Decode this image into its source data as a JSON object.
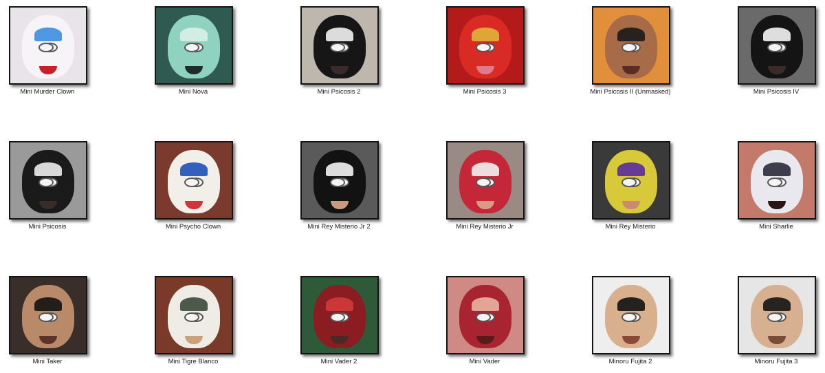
{
  "items": [
    {
      "label": "Mini Murder Clown",
      "icon": "clown-mask-icon",
      "bg": "#e9e4ea",
      "face": "#f7f4f7",
      "accent": "#3a8de0",
      "mouth": "#c8202a"
    },
    {
      "label": "Mini Nova",
      "icon": "mask-icon",
      "bg": "#2f5a52",
      "face": "#8fd2c0",
      "accent": "#d9f1e8",
      "mouth": "#1f2d2a"
    },
    {
      "label": "Mini Psicosis 2",
      "icon": "mask-icon",
      "bg": "#bdb7ae",
      "face": "#161616",
      "accent": "#f2f2f2",
      "mouth": "#3a2a2a"
    },
    {
      "label": "Mini Psicosis 3",
      "icon": "mask-icon",
      "bg": "#b51a1a",
      "face": "#d92a24",
      "accent": "#e0b23a",
      "mouth": "#e07a8a"
    },
    {
      "label": "Mini Psicosis II (Unmasked)",
      "icon": "face-icon",
      "bg": "#e28f3c",
      "face": "#a86b48",
      "accent": "#1a1a1a",
      "mouth": "#5a2d22"
    },
    {
      "label": "Mini Psicosis IV",
      "icon": "mask-icon",
      "bg": "#6a6a6a",
      "face": "#141414",
      "accent": "#f4f4f4",
      "mouth": "#3a2a2a"
    },
    {
      "label": "Mini Psicosis",
      "icon": "mask-icon",
      "bg": "#9a9a9a",
      "face": "#1a1a1a",
      "accent": "#ededed",
      "mouth": "#3a2a2a"
    },
    {
      "label": "Mini Psycho Clown",
      "icon": "clown-mask-icon",
      "bg": "#7a3a2e",
      "face": "#f2efe9",
      "accent": "#1e4fb8",
      "mouth": "#d2343c"
    },
    {
      "label": "Mini Rey Misterio Jr 2",
      "icon": "mask-icon",
      "bg": "#5a5a5a",
      "face": "#121212",
      "accent": "#f4f4f4",
      "mouth": "#c89a82"
    },
    {
      "label": "Mini Rey Misterio Jr",
      "icon": "mask-icon",
      "bg": "#9a8a84",
      "face": "#c42838",
      "accent": "#f1f1f1",
      "mouth": "#d99a86"
    },
    {
      "label": "Mini Rey Misterio",
      "icon": "mask-icon",
      "bg": "#3a3a3a",
      "face": "#d8c93a",
      "accent": "#5a2aa0",
      "mouth": "#c98a70"
    },
    {
      "label": "Mini Sharlie",
      "icon": "face-paint-icon",
      "bg": "#c47a6a",
      "face": "#e8e8ee",
      "accent": "#2a2a3a",
      "mouth": "#2a1414"
    },
    {
      "label": "Mini Taker",
      "icon": "face-icon",
      "bg": "#3a2e2a",
      "face": "#b98a6a",
      "accent": "#121212",
      "mouth": "#5a3426"
    },
    {
      "label": "Mini Tigre Blanco",
      "icon": "mask-icon",
      "bg": "#7a3a2a",
      "face": "#efece6",
      "accent": "#3a4a3a",
      "mouth": "#c7a27a"
    },
    {
      "label": "Mini Vader 2",
      "icon": "mask-icon",
      "bg": "#2e5a3a",
      "face": "#8a1c22",
      "accent": "#d23a3a",
      "mouth": "#4a2a22"
    },
    {
      "label": "Mini Vader",
      "icon": "mask-icon",
      "bg": "#d08a86",
      "face": "#a82430",
      "accent": "#e8b2a0",
      "mouth": "#5a1a1a"
    },
    {
      "label": "Minoru Fujita 2",
      "icon": "face-icon",
      "bg": "#eeeeee",
      "face": "#d8b08e",
      "accent": "#121212",
      "mouth": "#8a4a3a"
    },
    {
      "label": "Minoru Fujita 3",
      "icon": "face-icon",
      "bg": "#e6e6e6",
      "face": "#d6b090",
      "accent": "#141414",
      "mouth": "#7a4a3a"
    }
  ]
}
